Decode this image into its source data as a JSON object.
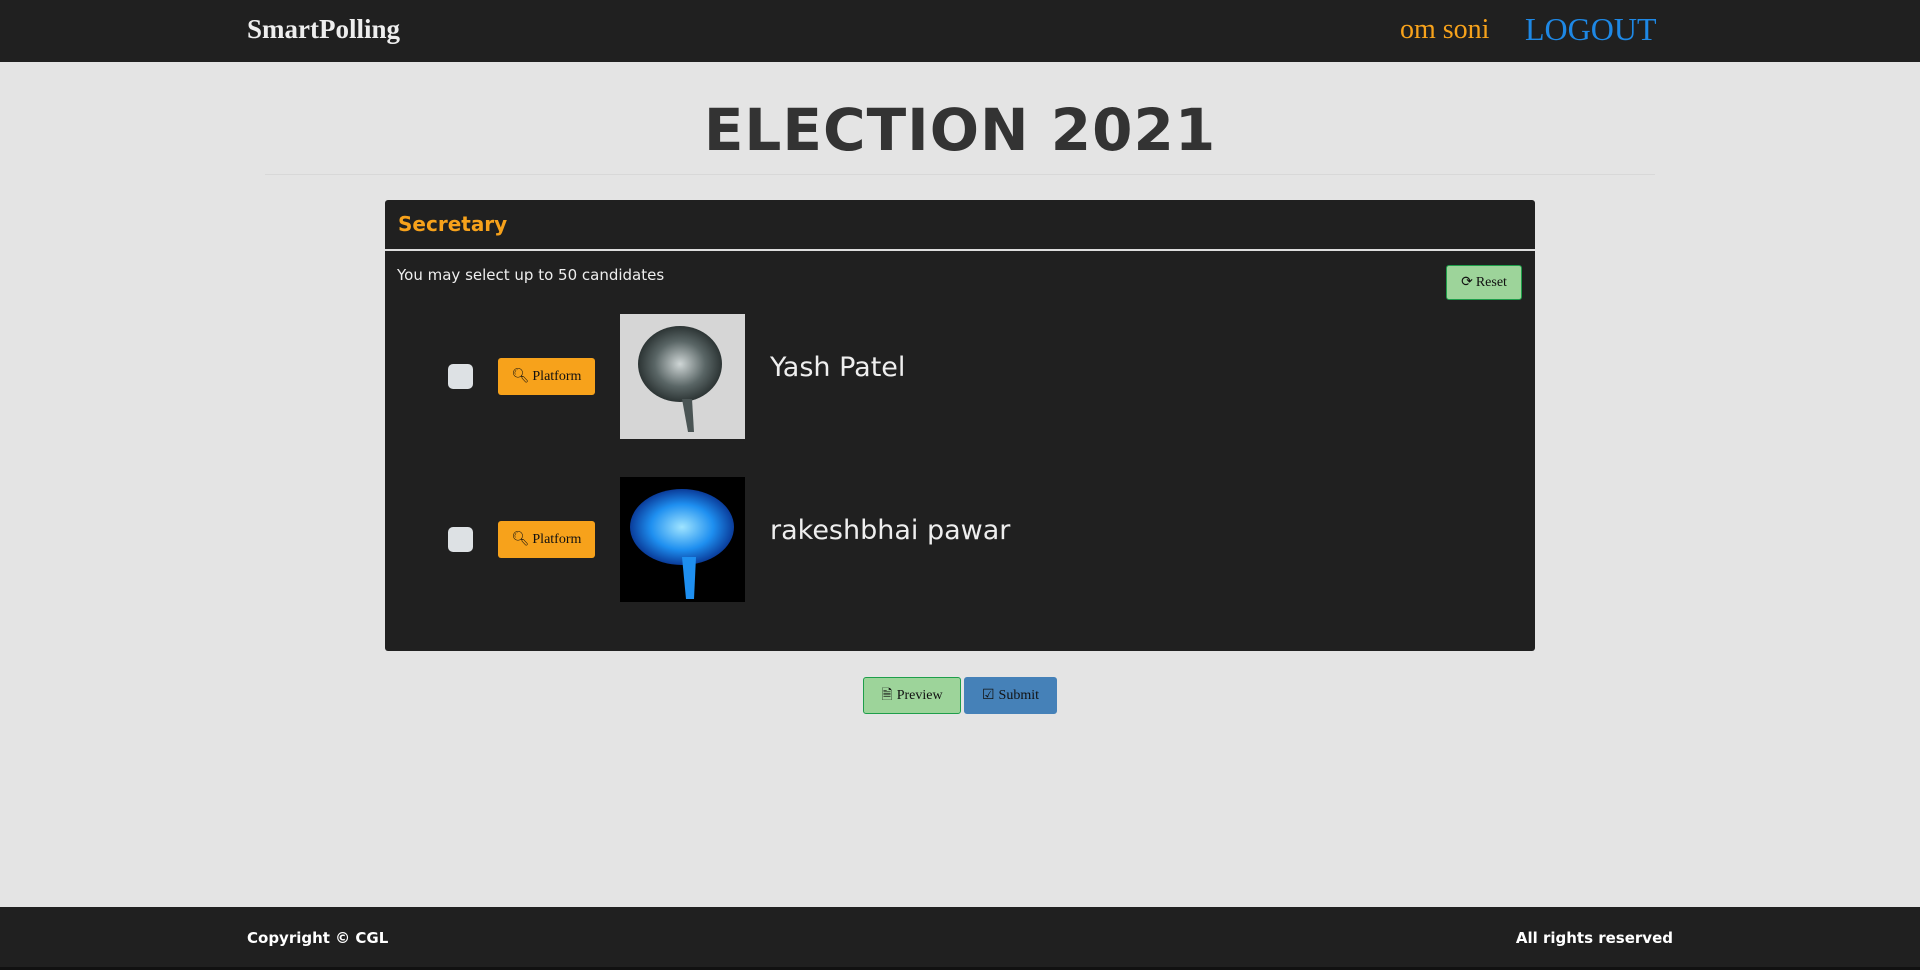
{
  "navbar": {
    "brand": "SmartPolling",
    "user_name": "om soni",
    "logout_label": "LOGOUT"
  },
  "page": {
    "title": "ELECTION 2021"
  },
  "ballot": {
    "position": "Secretary",
    "hint": "You may select up to 50 candidates",
    "reset_label": "Reset",
    "candidates": [
      {
        "name": "Yash Patel",
        "platform_label": "Platform",
        "checked": false,
        "photo": "metallic-brain-image"
      },
      {
        "name": "rakeshbhai pawar",
        "platform_label": "Platform",
        "checked": false,
        "photo": "blue-brain-image"
      }
    ]
  },
  "actions": {
    "preview_label": "Preview",
    "submit_label": "Submit"
  },
  "footer": {
    "copyright": "Copyright © CGL",
    "rights": "All rights reserved"
  },
  "colors": {
    "navbar": "#202020",
    "accent": "#f7a21b",
    "logout": "#1e88e5",
    "preview": "#9dd49a",
    "submit": "#4581b8"
  }
}
